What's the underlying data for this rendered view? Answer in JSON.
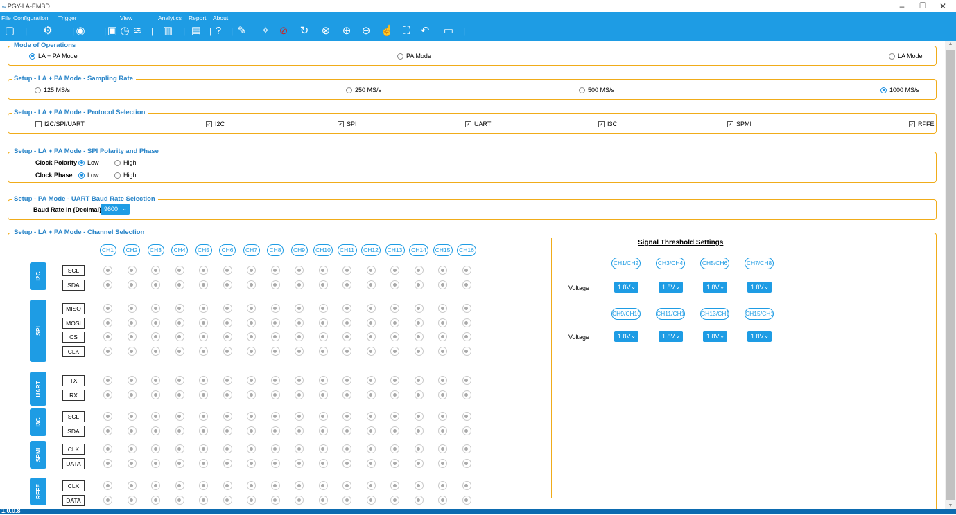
{
  "app": {
    "title": "PGY-LA-EMBD",
    "version": "1.0.0.8"
  },
  "menu": [
    "File",
    "Configuration",
    "Trigger",
    "View",
    "Analytics",
    "Report",
    "About"
  ],
  "toolbar_icons": [
    "new-file-icon",
    "settings-icon",
    "trigger-icon",
    "acquire-icon",
    "clock-icon",
    "waveform-icon",
    "analytics-icon",
    "report-icon",
    "help-icon",
    "pen-icon",
    "probe-icon",
    "stop-icon",
    "refresh-icon",
    "no-entry-icon",
    "zoom-in-icon",
    "zoom-out-icon",
    "pan-hand-icon",
    "fit-icon",
    "undo-icon",
    "chart-icon"
  ],
  "mode": {
    "legend": "Mode of Operations",
    "options": [
      "LA + PA Mode",
      "PA Mode",
      "LA Mode"
    ],
    "selected": 0
  },
  "sampling": {
    "legend": "Setup - LA + PA Mode - Sampling Rate",
    "options": [
      "125 MS/s",
      "250 MS/s",
      "500 MS/s",
      "1000 MS/s"
    ],
    "selected": 3
  },
  "protocols": {
    "legend": "Setup - LA + PA Mode - Protocol Selection",
    "items": [
      {
        "label": "I2C/SPI/UART",
        "checked": false
      },
      {
        "label": "I2C",
        "checked": true
      },
      {
        "label": "SPI",
        "checked": true
      },
      {
        "label": "UART",
        "checked": true
      },
      {
        "label": "I3C",
        "checked": true
      },
      {
        "label": "SPMI",
        "checked": true
      },
      {
        "label": "RFFE",
        "checked": true
      }
    ]
  },
  "spi": {
    "legend": "Setup - LA + PA Mode - SPI Polarity and Phase",
    "rows": [
      {
        "label": "Clock Polarity",
        "options": [
          "Low",
          "High"
        ],
        "selected": 0
      },
      {
        "label": "Clock Phase",
        "options": [
          "Low",
          "High"
        ],
        "selected": 0
      }
    ]
  },
  "uart": {
    "legend": "Setup - PA Mode - UART Baud Rate Selection",
    "label": "Baud Rate in (Decimal)",
    "value": "9600"
  },
  "channels": {
    "legend": "Setup - LA + PA Mode - Channel Selection",
    "names": [
      "CH1",
      "CH2",
      "CH3",
      "CH4",
      "CH5",
      "CH6",
      "CH7",
      "CH8",
      "CH9",
      "CH10",
      "CH11",
      "CH12",
      "CH13",
      "CH14",
      "CH15",
      "CH16"
    ],
    "groups": [
      {
        "name": "I2C",
        "signals": [
          "SCL",
          "SDA"
        ]
      },
      {
        "name": "SPI",
        "signals": [
          "MISO",
          "MOSI",
          "CS",
          "CLK"
        ]
      },
      {
        "name": "UART",
        "signals": [
          "TX",
          "RX"
        ]
      },
      {
        "name": "I3C",
        "signals": [
          "SCL",
          "SDA"
        ]
      },
      {
        "name": "SPMI",
        "signals": [
          "CLK",
          "DATA"
        ]
      },
      {
        "name": "RFFE",
        "signals": [
          "CLK",
          "DATA"
        ]
      }
    ]
  },
  "threshold": {
    "title": "Signal Threshold Settings",
    "voltage_label": "Voltage",
    "rows": [
      {
        "pairs": [
          "CH1/CH2",
          "CH3/CH4",
          "CH5/CH6",
          "CH7/CH8"
        ],
        "values": [
          "1.8V",
          "1.8V",
          "1.8V",
          "1.8V"
        ]
      },
      {
        "pairs": [
          "CH9/CH10",
          "CH11/CH12",
          "CH13/CH14",
          "CH15/CH16"
        ],
        "values": [
          "1.8V",
          "1.8V",
          "1.8V",
          "1.8V"
        ]
      }
    ]
  },
  "colors": {
    "accent": "#1e9ce4",
    "border": "#f0ac1a",
    "legend": "#2a85c8",
    "status": "#0c6bb0"
  }
}
